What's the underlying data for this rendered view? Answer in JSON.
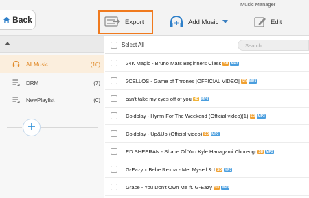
{
  "window": {
    "title": "Music Manager"
  },
  "toolbar": {
    "back_label": "Back",
    "export_label": "Export",
    "add_music_label": "Add Music",
    "edit_label": "Edit"
  },
  "sidebar": {
    "items": [
      {
        "label": "All Music",
        "count": "(16)",
        "icon": "headphones-icon",
        "active": true
      },
      {
        "label": "DRM",
        "count": "(7)",
        "icon": "playlist-icon",
        "active": false
      },
      {
        "label": "NewPlaylist",
        "count": "(0)",
        "icon": "playlist-icon",
        "active": false
      }
    ]
  },
  "list": {
    "select_all_label": "Select All",
    "search_placeholder": "Search",
    "tracks": [
      {
        "title": "24K Magic - Bruno Mars   Beginners Class",
        "quality": "SD",
        "format": "MP3"
      },
      {
        "title": "2CELLOS - Game of Thrones [OFFICIAL VIDEO]",
        "quality": "SD",
        "format": "MP3"
      },
      {
        "title": "can't take my eyes off of you",
        "quality": "HD",
        "format": "MP3"
      },
      {
        "title": "Coldplay - Hymn For The Weekend (Official video)(1)",
        "quality": "SD",
        "format": "MP3"
      },
      {
        "title": "Coldplay - Up&Up (Official video)",
        "quality": "SD",
        "format": "MP3"
      },
      {
        "title": "ED SHEERAN - Shape Of You   Kyle Hanagami Choreogr",
        "quality": "SD",
        "format": "MP3"
      },
      {
        "title": "G-Eazy x Bebe Rexha - Me, Myself & I",
        "quality": "SD",
        "format": "MP3"
      },
      {
        "title": "Grace - You Don't Own Me ft. G-Eazy",
        "quality": "SD",
        "format": "MP3"
      }
    ]
  },
  "colors": {
    "accent": "#f07a1e",
    "active_text": "#e08a2a",
    "active_bg": "#fbeedd",
    "badge_sd": "#f0a030",
    "badge_mp3": "#4a9ede",
    "icon_blue": "#2e7fc9"
  }
}
